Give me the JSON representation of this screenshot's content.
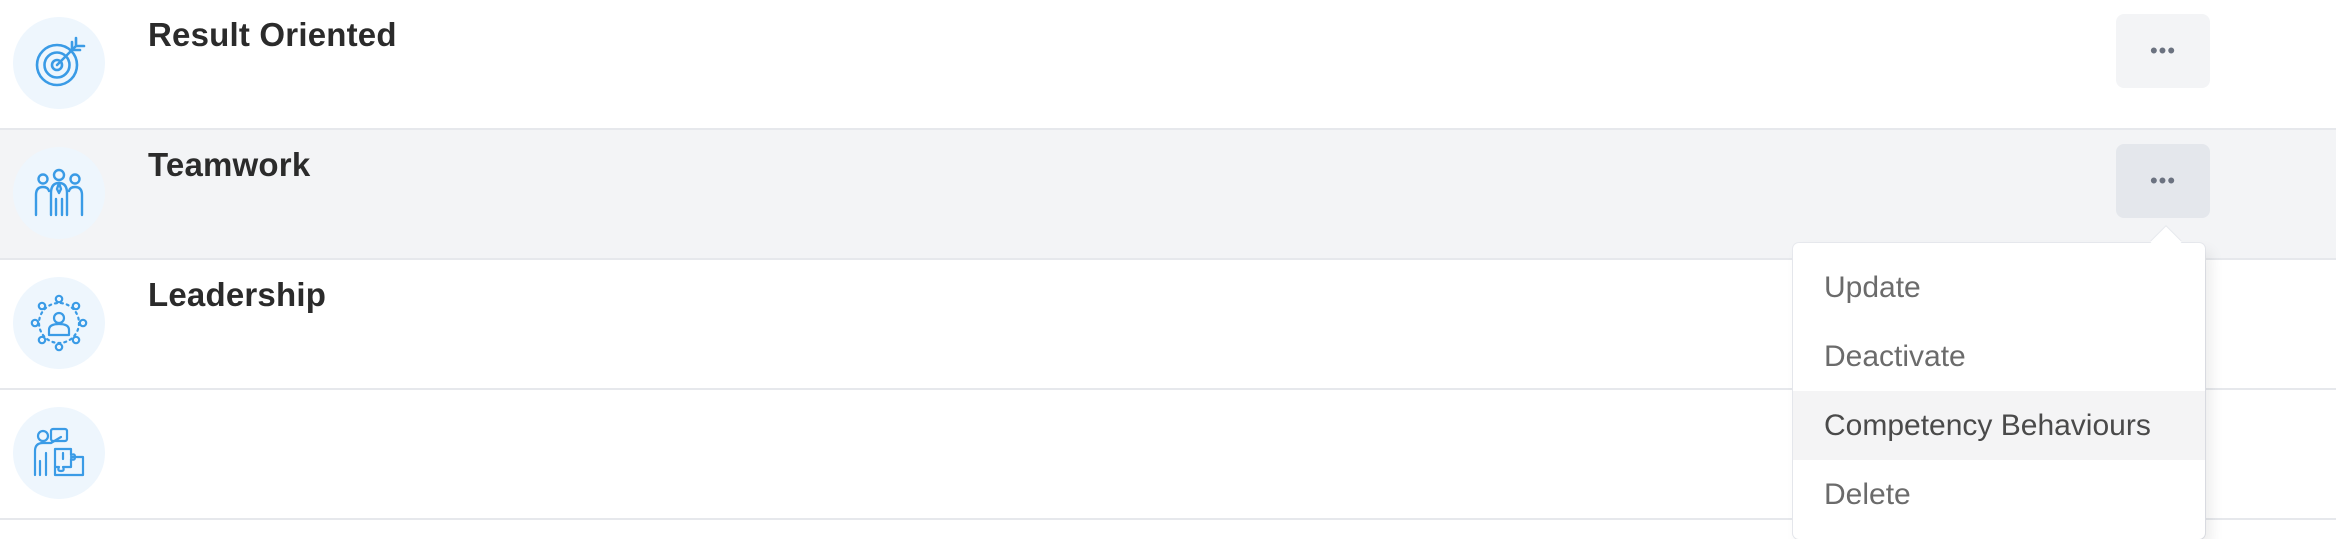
{
  "rows": [
    {
      "title": "Result Oriented",
      "icon": "target-arrow-icon",
      "more_label": "•••"
    },
    {
      "title": "Teamwork",
      "icon": "team-people-icon",
      "more_label": "•••"
    },
    {
      "title": "Leadership",
      "icon": "leader-network-icon",
      "more_label": "•••"
    },
    {
      "title": "",
      "icon": "presenter-puzzle-icon"
    }
  ],
  "menu": {
    "items": [
      "Update",
      "Deactivate",
      "Competency Behaviours",
      "Delete"
    ],
    "active_index": 2
  },
  "colors": {
    "icon_blue": "#3a9be6",
    "icon_bg": "#eef6fd",
    "hover_row": "#f3f4f6"
  }
}
